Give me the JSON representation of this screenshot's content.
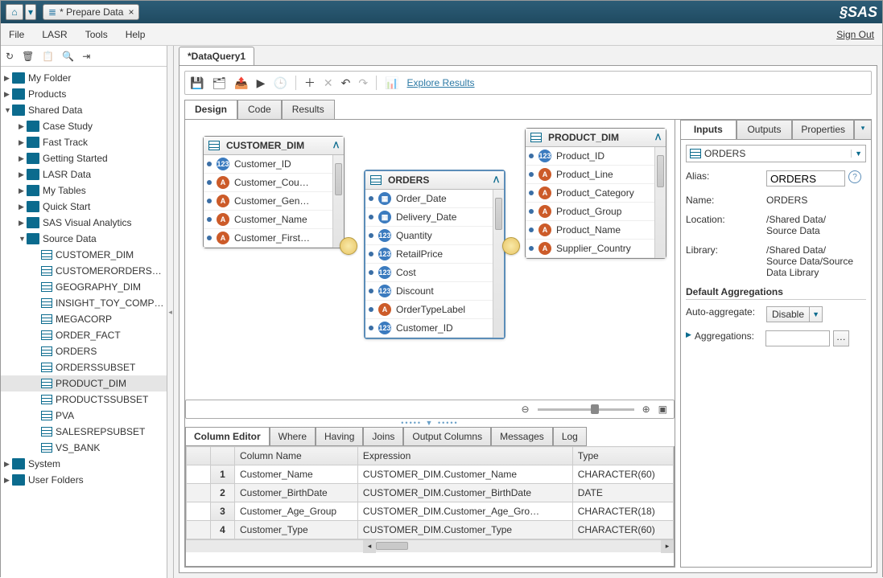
{
  "topbar": {
    "tab_title": "* Prepare Data",
    "brand": "SAS"
  },
  "menubar": {
    "file": "File",
    "lasr": "LASR",
    "tools": "Tools",
    "help": "Help",
    "signout": "Sign Out"
  },
  "sidebar": {
    "root": [
      {
        "label": "My Folder",
        "icon": "folder",
        "expanded": false
      },
      {
        "label": "Products",
        "icon": "folder",
        "expanded": false
      },
      {
        "label": "Shared Data",
        "icon": "folder",
        "expanded": true,
        "children": [
          {
            "label": "Case Study",
            "icon": "folder"
          },
          {
            "label": "Fast Track",
            "icon": "folder"
          },
          {
            "label": "Getting Started",
            "icon": "folder"
          },
          {
            "label": "LASR Data",
            "icon": "folder"
          },
          {
            "label": "My Tables",
            "icon": "star"
          },
          {
            "label": "Quick Start",
            "icon": "folder"
          },
          {
            "label": "SAS Visual Analytics",
            "icon": "folder"
          },
          {
            "label": "Source Data",
            "icon": "folder",
            "expanded": true,
            "children": [
              {
                "label": "CUSTOMER_DIM",
                "icon": "table"
              },
              {
                "label": "CUSTOMERORDERS…",
                "icon": "table"
              },
              {
                "label": "GEOGRAPHY_DIM",
                "icon": "table"
              },
              {
                "label": "INSIGHT_TOY_COMP…",
                "icon": "table"
              },
              {
                "label": "MEGACORP",
                "icon": "table"
              },
              {
                "label": "ORDER_FACT",
                "icon": "table"
              },
              {
                "label": "ORDERS",
                "icon": "table"
              },
              {
                "label": "ORDERSSUBSET",
                "icon": "table"
              },
              {
                "label": "PRODUCT_DIM",
                "icon": "table",
                "selected": true
              },
              {
                "label": "PRODUCTSSUBSET",
                "icon": "table"
              },
              {
                "label": "PVA",
                "icon": "table"
              },
              {
                "label": "SALESREPSUBSET",
                "icon": "table"
              },
              {
                "label": "VS_BANK",
                "icon": "table"
              }
            ]
          }
        ]
      },
      {
        "label": "System",
        "icon": "folder",
        "expanded": false
      },
      {
        "label": "User Folders",
        "icon": "folder",
        "expanded": false
      }
    ]
  },
  "doc": {
    "tab": "*DataQuery1",
    "explore": "Explore Results"
  },
  "view_tabs": {
    "design": "Design",
    "code": "Code",
    "results": "Results"
  },
  "entities": {
    "customer": {
      "title": "CUSTOMER_DIM",
      "fields": [
        {
          "t": "123",
          "n": "Customer_ID"
        },
        {
          "t": "A",
          "n": "Customer_Cou…"
        },
        {
          "t": "A",
          "n": "Customer_Gen…"
        },
        {
          "t": "A",
          "n": "Customer_Name"
        },
        {
          "t": "A",
          "n": "Customer_First…"
        }
      ]
    },
    "orders": {
      "title": "ORDERS",
      "fields": [
        {
          "t": "cal",
          "n": "Order_Date"
        },
        {
          "t": "cal",
          "n": "Delivery_Date"
        },
        {
          "t": "123",
          "n": "Quantity"
        },
        {
          "t": "123",
          "n": "RetailPrice"
        },
        {
          "t": "123",
          "n": "Cost"
        },
        {
          "t": "123",
          "n": "Discount"
        },
        {
          "t": "A",
          "n": "OrderTypeLabel"
        },
        {
          "t": "123",
          "n": "Customer_ID"
        }
      ]
    },
    "product": {
      "title": "PRODUCT_DIM",
      "fields": [
        {
          "t": "123",
          "n": "Product_ID"
        },
        {
          "t": "A",
          "n": "Product_Line"
        },
        {
          "t": "A",
          "n": "Product_Category"
        },
        {
          "t": "A",
          "n": "Product_Group"
        },
        {
          "t": "A",
          "n": "Product_Name"
        },
        {
          "t": "A",
          "n": "Supplier_Country"
        }
      ]
    }
  },
  "bottom_tabs": {
    "col_editor": "Column Editor",
    "where": "Where",
    "having": "Having",
    "joins": "Joins",
    "output": "Output Columns",
    "messages": "Messages",
    "log": "Log"
  },
  "grid": {
    "headers": {
      "col": "Column Name",
      "expr": "Expression",
      "type": "Type"
    },
    "rows": [
      {
        "n": "1",
        "col": "Customer_Name",
        "expr": "CUSTOMER_DIM.Customer_Name",
        "type": "CHARACTER(60)"
      },
      {
        "n": "2",
        "col": "Customer_BirthDate",
        "expr": "CUSTOMER_DIM.Customer_BirthDate",
        "type": "DATE"
      },
      {
        "n": "3",
        "col": "Customer_Age_Group",
        "expr": "CUSTOMER_DIM.Customer_Age_Gro…",
        "type": "CHARACTER(18)"
      },
      {
        "n": "4",
        "col": "Customer_Type",
        "expr": "CUSTOMER_DIM.Customer_Type",
        "type": "CHARACTER(60)"
      }
    ]
  },
  "props": {
    "tabs": {
      "inputs": "Inputs",
      "outputs": "Outputs",
      "properties": "Properties"
    },
    "selected": "ORDERS",
    "alias_label": "Alias:",
    "alias_value": "ORDERS",
    "name_label": "Name:",
    "name_value": "ORDERS",
    "location_label": "Location:",
    "location_value": "/Shared Data/\nSource Data",
    "library_label": "Library:",
    "library_value": "/Shared Data/\nSource Data/Source\nData Library",
    "section": "Default Aggregations",
    "autoagg_label": "Auto-aggregate:",
    "autoagg_value": "Disable",
    "agg_label": "Aggregations:"
  }
}
